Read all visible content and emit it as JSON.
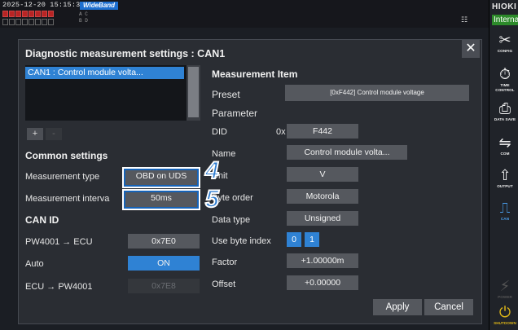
{
  "status": {
    "datetime": "2025-12-20 15:15:31",
    "mode_badge": "WideBand",
    "ab_top": "A C",
    "ab_bottom": "B D"
  },
  "brand": {
    "name": "HIOKI",
    "storage": "Interna"
  },
  "sidebar": [
    {
      "icon": "config-icon",
      "glyph": "✂",
      "label": "CONFIG"
    },
    {
      "icon": "timer-icon",
      "glyph": "⏱",
      "label": "TIME CONTROL"
    },
    {
      "icon": "data-save-icon",
      "glyph": "⎙",
      "label": "DATA SAVE"
    },
    {
      "icon": "com-icon",
      "glyph": "⇋",
      "label": "COM"
    },
    {
      "icon": "output-icon",
      "glyph": "⇧",
      "label": "OUTPUT"
    },
    {
      "icon": "can-icon",
      "glyph": "⎍",
      "label": "CAN"
    },
    {
      "icon": "power-icon",
      "glyph": "⚡",
      "label": "POWER"
    },
    {
      "icon": "shutdown-icon",
      "glyph": "⏻",
      "label": "SHUTDOWN"
    }
  ],
  "dialog": {
    "title": "Diagnostic measurement settings : CAN1",
    "close_glyph": "✕",
    "list": {
      "selected_item": "CAN1 : Control module volta..."
    },
    "add_label": "+",
    "remove_label": "-",
    "common_settings": {
      "heading": "Common settings",
      "measurement_type_label": "Measurement type",
      "measurement_type_value": "OBD on UDS",
      "measurement_interval_label": "Measurement interva",
      "measurement_interval_value": "50ms"
    },
    "can_id": {
      "heading": "CAN ID",
      "pw_to_ecu_label": "PW4001 → ECU",
      "pw_to_ecu_value": "0x7E0",
      "auto_label": "Auto",
      "auto_value": "ON",
      "ecu_to_pw_label": "ECU → PW4001",
      "ecu_to_pw_value": "0x7E8"
    },
    "measurement_item": {
      "heading": "Measurement Item",
      "preset_label": "Preset",
      "preset_value": "[0xF442] Control module voltage",
      "parameter_heading": "Parameter",
      "did_label": "DID",
      "did_prefix": "0x",
      "did_value": "F442",
      "name_label": "Name",
      "name_value": "Control module volta...",
      "unit_label": "Unit",
      "unit_value": "V",
      "byte_order_label": "Byte order",
      "byte_order_value": "Motorola",
      "data_type_label": "Data type",
      "data_type_value": "Unsigned",
      "byte_index_label": "Use byte index",
      "byte_index_options": [
        "0",
        "1"
      ],
      "factor_label": "Factor",
      "factor_value": "+1.00000m",
      "offset_label": "Offset",
      "offset_value": "+0.00000"
    },
    "apply_label": "Apply",
    "cancel_label": "Cancel"
  },
  "callouts": {
    "first": "4",
    "second": "5"
  },
  "colors": {
    "accent": "#2f82d4",
    "dialog_bg": "#2a2d33",
    "field_bg": "#55585e",
    "callout": "#2c7bd0"
  }
}
